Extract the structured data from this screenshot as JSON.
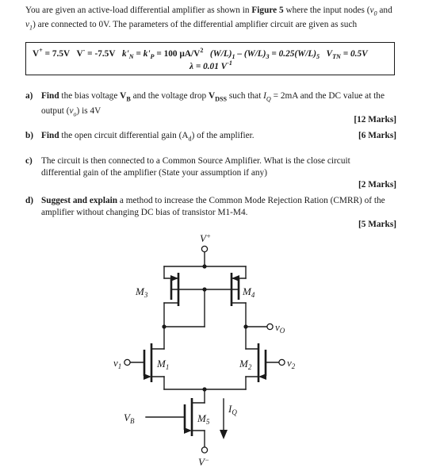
{
  "intro": {
    "line1_a": "You are given an active-load differential amplifier as shown in ",
    "line1_b": "Figure 5",
    "line1_c": " where the input nodes (",
    "v0": "v",
    "v0sub": "0",
    "and": " and ",
    "v1": "v",
    "v1sub": "1",
    "line1_d": ") are connected to 0V. The parameters of the differential amplifier circuit are given as such"
  },
  "params": {
    "vplus": "V",
    "vplus_sup": "+",
    "vplus_val": " = 7.5V",
    "vminus": "V",
    "vminus_sup": "-",
    "vminus_val": " = -7.5V",
    "kn": "k'",
    "kn_sub": "N",
    "eq1": " = ",
    "kp": "k'",
    "kp_sub": "P",
    "kval": " = 100 µA/V",
    "kval_sup": "2",
    "wl1": "(W/L)",
    "wl1_sub": "1",
    "eq2": " – ",
    "wl3": "(W/L)",
    "wl3_sub": "3",
    "eq3": " = 0.25(W/L)",
    "wl5_sub": "5",
    "vtn": "V",
    "vtn_sub": "TN",
    "vtn_val": " = 0.5V",
    "lambda_line": "λ = 0.01 V",
    "lambda_sup": "-1"
  },
  "questions": [
    {
      "label": "a)",
      "text_bold1": "Find",
      "text1": " the bias voltage ",
      "vb": "V",
      "vb_sub": "B",
      "text2": " and the voltage drop ",
      "vdss": "V",
      "vdss_sub": "DSS",
      "text3": " such that ",
      "iq": "I",
      "iq_sub": "Q",
      "text4": " = 2mA and the DC value at the output (",
      "vo": "v",
      "vo_sub": "o",
      "text5": ") is 4V",
      "marks": "[12 Marks]"
    },
    {
      "label": "b)",
      "text_bold1": "Find",
      "text1": " the open circuit differential gain (A",
      "ad_sub": "d",
      "text2": ") of the amplifier.",
      "marks": "[6 Marks]"
    },
    {
      "label": "c)",
      "text1": "The circuit is then connected to a Common Source Amplifier. What is the close circuit differential gain of the amplifier (State your assumption if any)",
      "marks": "[2 Marks]"
    },
    {
      "label": "d)",
      "text_bold1": "Suggest and explain",
      "text1": " a method to increase the Common Mode Rejection Ration (CMRR) of the amplifier without changing DC bias of transistor M1-M4.",
      "marks": "[5 Marks]"
    }
  ],
  "circuit": {
    "labels": {
      "vplus": "V",
      "vplus_sup": "+",
      "vminus": "V",
      "vminus_sup": "−",
      "m1": "M",
      "m1_sub": "1",
      "m2": "M",
      "m2_sub": "2",
      "m3": "M",
      "m3_sub": "3",
      "m4": "M",
      "m4_sub": "4",
      "m5": "M",
      "m5_sub": "5",
      "v1": "v",
      "v1_sub": "1",
      "v2": "v",
      "v2_sub": "2",
      "vo": "v",
      "vo_sub": "O",
      "vb": "V",
      "vb_sub": "B",
      "iq": "I",
      "iq_sub": "Q"
    },
    "stroke_color": "#1a1a1a"
  }
}
